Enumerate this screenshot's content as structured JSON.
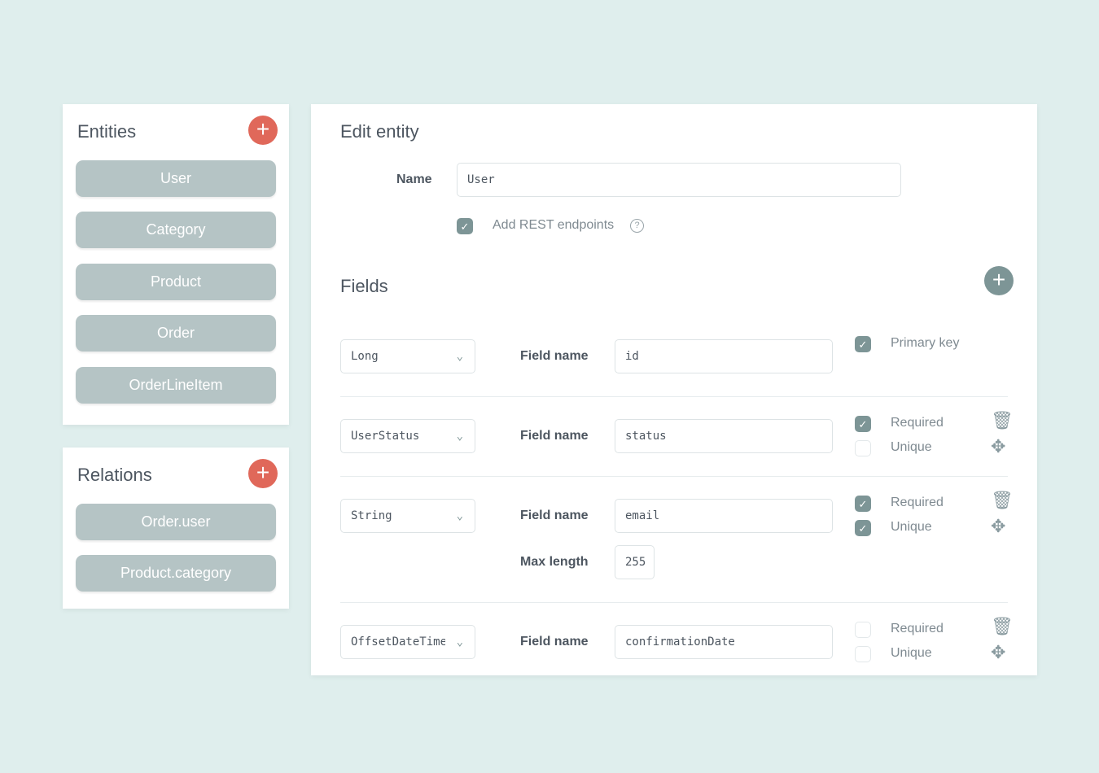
{
  "entities": {
    "title": "Entities",
    "add_icon": "plus-icon",
    "items": [
      "User",
      "Category",
      "Product",
      "Order",
      "OrderLineItem"
    ]
  },
  "relations": {
    "title": "Relations",
    "add_icon": "plus-icon",
    "items": [
      "Order.user",
      "Product.category"
    ]
  },
  "edit": {
    "title": "Edit entity",
    "name_label": "Name",
    "name_value": "User",
    "rest_label": "Add REST endpoints",
    "rest_checked": true,
    "help_icon": "question-circle-icon"
  },
  "fields": {
    "title": "Fields",
    "field_name_label": "Field name",
    "max_length_label": "Max length",
    "rows": [
      {
        "type": "Long",
        "name": "id",
        "options": [
          {
            "label": "Primary key",
            "checked": true
          }
        ]
      },
      {
        "type": "UserStatus",
        "name": "status",
        "options": [
          {
            "label": "Required",
            "checked": true
          },
          {
            "label": "Unique",
            "checked": false
          }
        ]
      },
      {
        "type": "String",
        "name": "email",
        "max_length": "255",
        "options": [
          {
            "label": "Required",
            "checked": true
          },
          {
            "label": "Unique",
            "checked": true
          }
        ]
      },
      {
        "type": "OffsetDateTime",
        "name": "confirmationDate",
        "options": [
          {
            "label": "Required",
            "checked": false
          },
          {
            "label": "Unique",
            "checked": false
          }
        ]
      }
    ]
  },
  "colors": {
    "background": "#dfeeed",
    "accent_red": "#e0685a",
    "accent_grey": "#7d9596",
    "entity_button": "#b5c4c5"
  }
}
